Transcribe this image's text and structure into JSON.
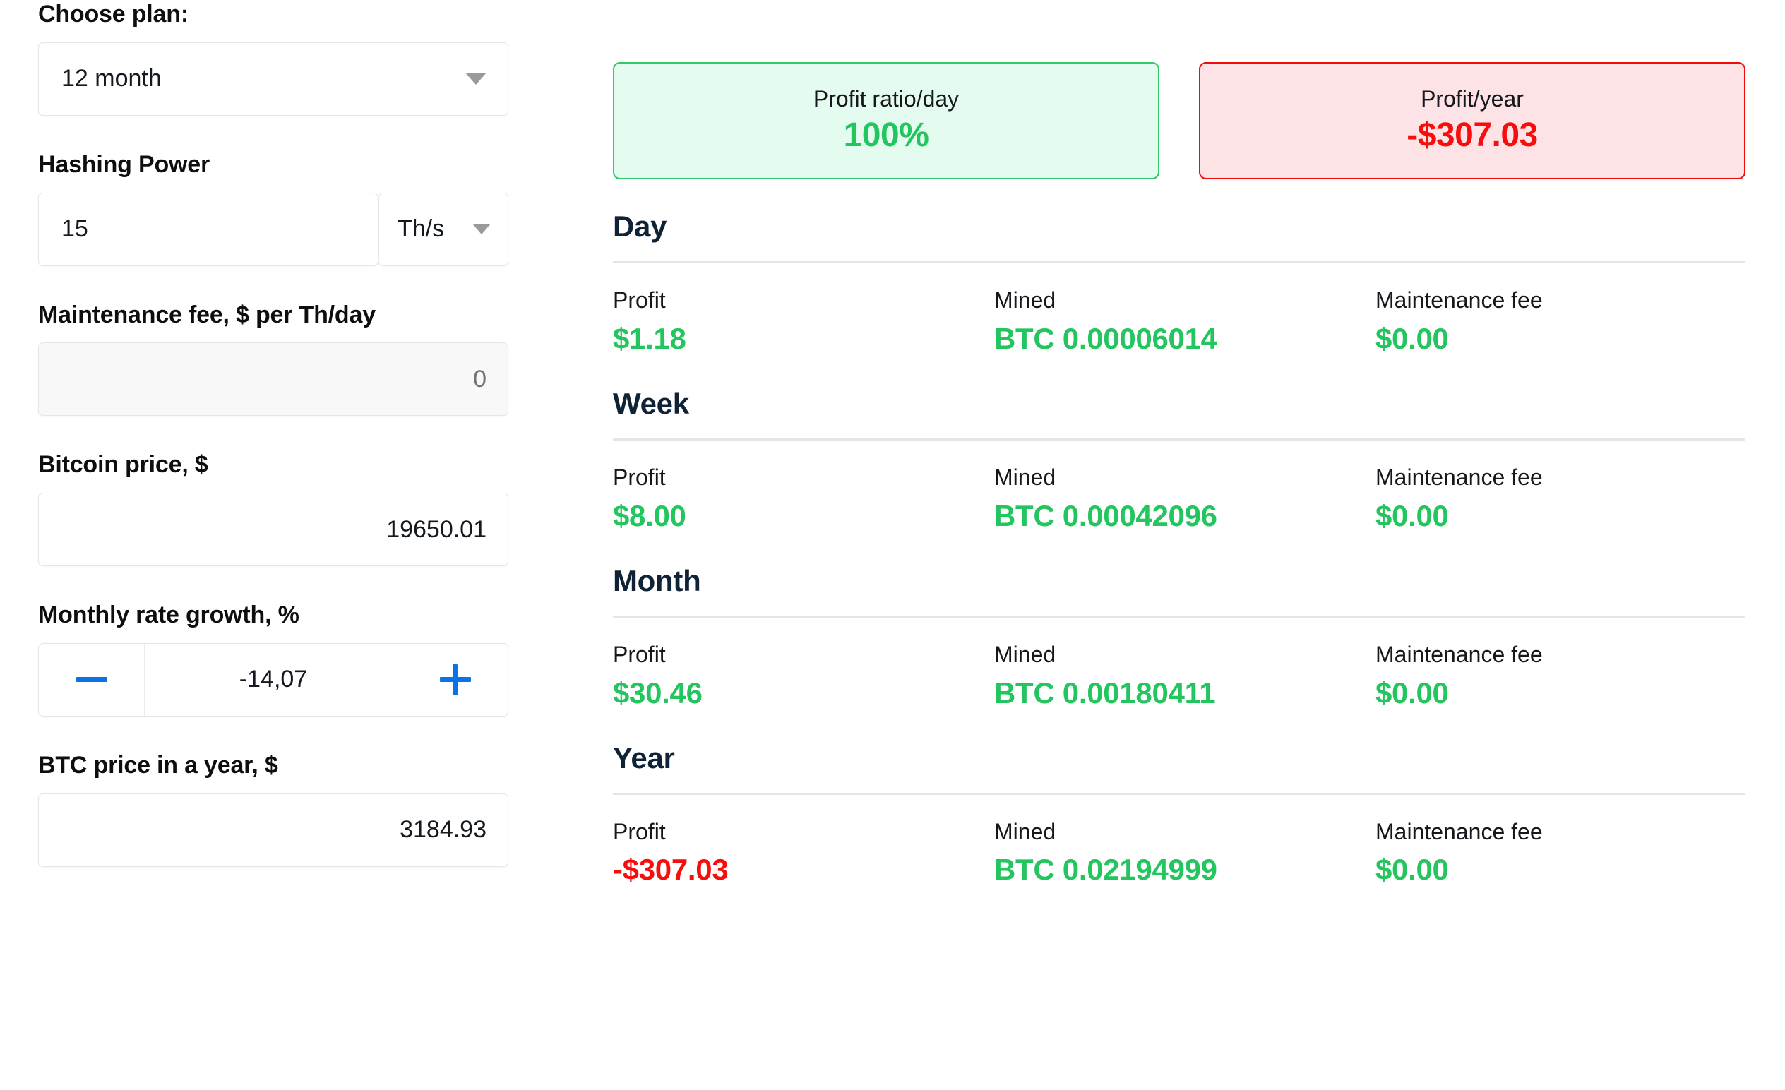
{
  "colors": {
    "green": "#23c55e",
    "red": "#f80d0d",
    "blue": "#0b74e5",
    "navy": "#0f2236",
    "green_card_bg": "#e4fcef",
    "green_card_border": "#2ecb6a",
    "red_card_bg": "#fde3e5",
    "red_card_border": "#f30b0b"
  },
  "form": {
    "plan": {
      "label": "Choose plan:",
      "value": "12 month",
      "icon": "chevron-down-icon"
    },
    "hashing_power": {
      "label": "Hashing Power",
      "value": "15",
      "unit": "Th/s",
      "icon": "chevron-down-icon"
    },
    "maintenance_fee": {
      "label": "Maintenance fee, $ per Th/day",
      "value": "0",
      "placeholder": "0"
    },
    "bitcoin_price": {
      "label": "Bitcoin price, $",
      "value": "19650.01"
    },
    "monthly_rate_growth": {
      "label": "Monthly rate growth, %",
      "value": "-14,07",
      "decrement_label": "−",
      "increment_label": "+"
    },
    "btc_price_in_year": {
      "label": "BTC price in a year, $",
      "value": "3184.93"
    }
  },
  "summary": [
    {
      "label": "Profit ratio/day",
      "value": "100%",
      "tone": "good"
    },
    {
      "label": "Profit/year",
      "value": "-$307.03",
      "tone": "bad"
    }
  ],
  "periods": [
    {
      "title": "Day",
      "metrics": [
        {
          "label": "Profit",
          "value": "$1.18",
          "tone": "pos"
        },
        {
          "label": "Mined",
          "value": "BTC 0.00006014",
          "tone": "pos"
        },
        {
          "label": "Maintenance fee",
          "value": "$0.00",
          "tone": "pos"
        }
      ]
    },
    {
      "title": "Week",
      "metrics": [
        {
          "label": "Profit",
          "value": "$8.00",
          "tone": "pos"
        },
        {
          "label": "Mined",
          "value": "BTC 0.00042096",
          "tone": "pos"
        },
        {
          "label": "Maintenance fee",
          "value": "$0.00",
          "tone": "pos"
        }
      ]
    },
    {
      "title": "Month",
      "metrics": [
        {
          "label": "Profit",
          "value": "$30.46",
          "tone": "pos"
        },
        {
          "label": "Mined",
          "value": "BTC 0.00180411",
          "tone": "pos"
        },
        {
          "label": "Maintenance fee",
          "value": "$0.00",
          "tone": "pos"
        }
      ]
    },
    {
      "title": "Year",
      "metrics": [
        {
          "label": "Profit",
          "value": "-$307.03",
          "tone": "neg"
        },
        {
          "label": "Mined",
          "value": "BTC 0.02194999",
          "tone": "pos"
        },
        {
          "label": "Maintenance fee",
          "value": "$0.00",
          "tone": "pos"
        }
      ]
    }
  ]
}
